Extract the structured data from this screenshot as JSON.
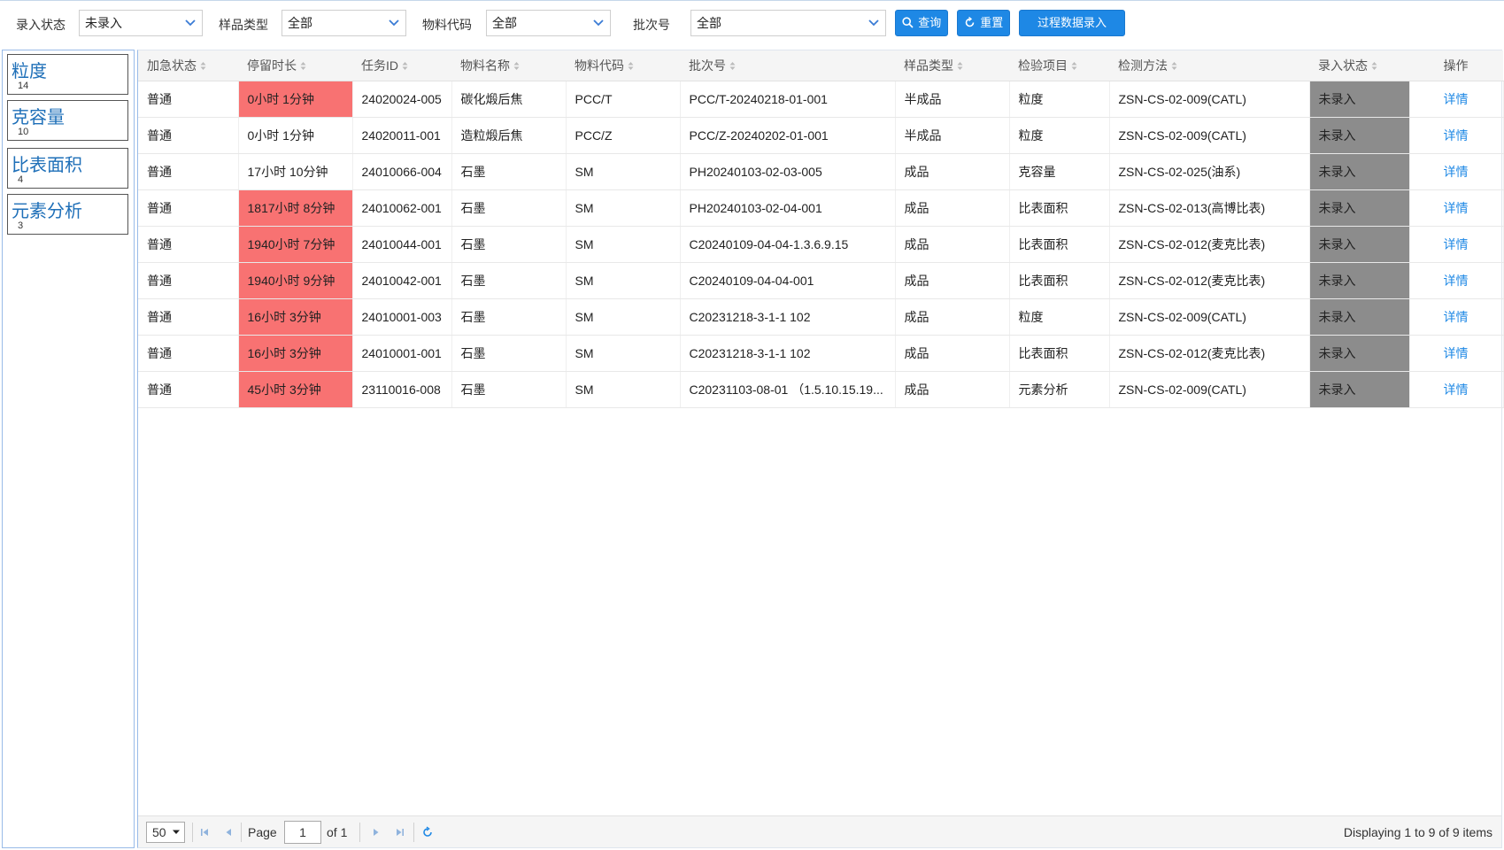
{
  "filters": {
    "entry_status": {
      "label": "录入状态",
      "value": "未录入"
    },
    "sample_type": {
      "label": "样品类型",
      "value": "全部"
    },
    "material_code": {
      "label": "物料代码",
      "value": "全部"
    },
    "batch_no": {
      "label": "批次号",
      "value": "全部"
    }
  },
  "buttons": {
    "query": "查询",
    "reset": "重置",
    "process_entry": "过程数据录入"
  },
  "sidebar": {
    "items": [
      {
        "name": "粒度",
        "count": "14"
      },
      {
        "name": "克容量",
        "count": "10"
      },
      {
        "name": "比表面积",
        "count": "4"
      },
      {
        "name": "元素分析",
        "count": "3"
      }
    ]
  },
  "table": {
    "columns": [
      "加急状态",
      "停留时长",
      "任务ID",
      "物料名称",
      "物料代码",
      "批次号",
      "样品类型",
      "检验项目",
      "检测方法",
      "录入状态",
      "操作"
    ],
    "rows": [
      {
        "urgency": "普通",
        "duration": "0小时 1分钟",
        "alarm": true,
        "task_id": "24020024-005",
        "material_name": "碳化煅后焦",
        "material_code": "PCC/T",
        "batch": "PCC/T-20240218-01-001",
        "sample_type": "半成品",
        "item": "粒度",
        "method": "ZSN-CS-02-009(CATL)",
        "status": "未录入",
        "op": "详情"
      },
      {
        "urgency": "普通",
        "duration": "0小时 1分钟",
        "alarm": false,
        "task_id": "24020011-001",
        "material_name": "造粒煅后焦",
        "material_code": "PCC/Z",
        "batch": "PCC/Z-20240202-01-001",
        "sample_type": "半成品",
        "item": "粒度",
        "method": "ZSN-CS-02-009(CATL)",
        "status": "未录入",
        "op": "详情"
      },
      {
        "urgency": "普通",
        "duration": "17小时 10分钟",
        "alarm": false,
        "task_id": "24010066-004",
        "material_name": "石墨",
        "material_code": "SM",
        "batch": "PH20240103-02-03-005",
        "sample_type": "成品",
        "item": "克容量",
        "method": "ZSN-CS-02-025(油系)",
        "status": "未录入",
        "op": "详情"
      },
      {
        "urgency": "普通",
        "duration": "1817小时 8分钟",
        "alarm": true,
        "task_id": "24010062-001",
        "material_name": "石墨",
        "material_code": "SM",
        "batch": "PH20240103-02-04-001",
        "sample_type": "成品",
        "item": "比表面积",
        "method": "ZSN-CS-02-013(高博比表)",
        "status": "未录入",
        "op": "详情"
      },
      {
        "urgency": "普通",
        "duration": "1940小时 7分钟",
        "alarm": true,
        "task_id": "24010044-001",
        "material_name": "石墨",
        "material_code": "SM",
        "batch": "C20240109-04-04-1.3.6.9.15",
        "sample_type": "成品",
        "item": "比表面积",
        "method": "ZSN-CS-02-012(麦克比表)",
        "status": "未录入",
        "op": "详情"
      },
      {
        "urgency": "普通",
        "duration": "1940小时 9分钟",
        "alarm": true,
        "task_id": "24010042-001",
        "material_name": "石墨",
        "material_code": "SM",
        "batch": "C20240109-04-04-001",
        "sample_type": "成品",
        "item": "比表面积",
        "method": "ZSN-CS-02-012(麦克比表)",
        "status": "未录入",
        "op": "详情"
      },
      {
        "urgency": "普通",
        "duration": "16小时 3分钟",
        "alarm": true,
        "task_id": "24010001-003",
        "material_name": "石墨",
        "material_code": "SM",
        "batch": "C20231218-3-1-1 102",
        "sample_type": "成品",
        "item": "粒度",
        "method": "ZSN-CS-02-009(CATL)",
        "status": "未录入",
        "op": "详情"
      },
      {
        "urgency": "普通",
        "duration": "16小时 3分钟",
        "alarm": true,
        "task_id": "24010001-001",
        "material_name": "石墨",
        "material_code": "SM",
        "batch": "C20231218-3-1-1 102",
        "sample_type": "成品",
        "item": "比表面积",
        "method": "ZSN-CS-02-012(麦克比表)",
        "status": "未录入",
        "op": "详情"
      },
      {
        "urgency": "普通",
        "duration": "45小时 3分钟",
        "alarm": true,
        "task_id": "23110016-008",
        "material_name": "石墨",
        "material_code": "SM",
        "batch": "C20231103-08-01 （1.5.10.15.19...",
        "sample_type": "成品",
        "item": "元素分析",
        "method": "ZSN-CS-02-009(CATL)",
        "status": "未录入",
        "op": "详情"
      }
    ]
  },
  "pager": {
    "page_size": "50",
    "page_label": "Page",
    "page": "1",
    "of_label": "of 1",
    "summary": "Displaying 1 to 9 of 9 items"
  },
  "colors": {
    "accent": "#1e88e5",
    "alarm": "#f87272",
    "status_bg": "#8c8c8c",
    "sidebar_text": "#1e6fb8"
  }
}
